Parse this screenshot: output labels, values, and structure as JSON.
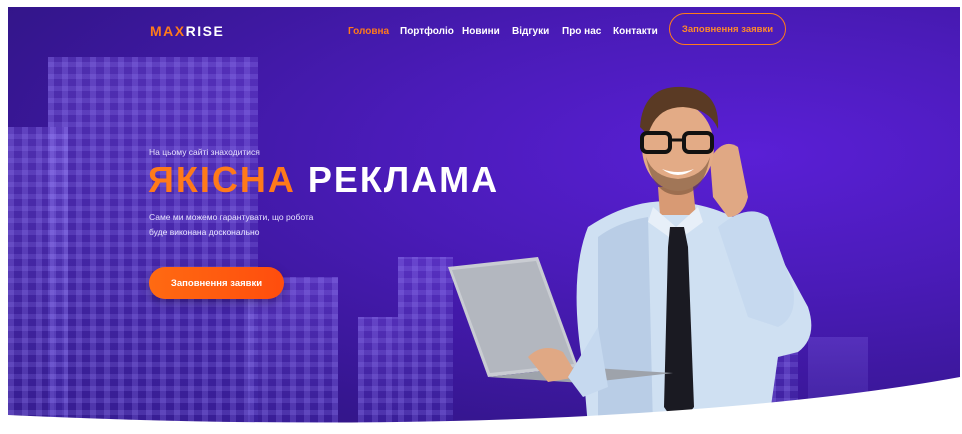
{
  "logo": {
    "part1": "MAX",
    "part2": "RISE"
  },
  "nav": {
    "items": [
      {
        "label": "Головна",
        "active": true
      },
      {
        "label": "Портфоліо",
        "active": false
      },
      {
        "label": "Новини",
        "active": false
      },
      {
        "label": "Відгуки",
        "active": false
      },
      {
        "label": "Про нас",
        "active": false
      },
      {
        "label": "Контакти",
        "active": false
      }
    ],
    "cta_label": "Заповнення заявки"
  },
  "hero": {
    "eyebrow": "На цьому сайті знаходитися",
    "headline_accent": "ЯКІСНА",
    "headline_rest": "РЕКЛАМА",
    "description_line1": "Саме ми можемо гарантувати, що робота",
    "description_line2": "буде виконана досконально",
    "cta_label": "Заповнення заявки"
  },
  "colors": {
    "accent": "#ff7a1a",
    "background": "#3a1799",
    "text": "#ffffff"
  }
}
